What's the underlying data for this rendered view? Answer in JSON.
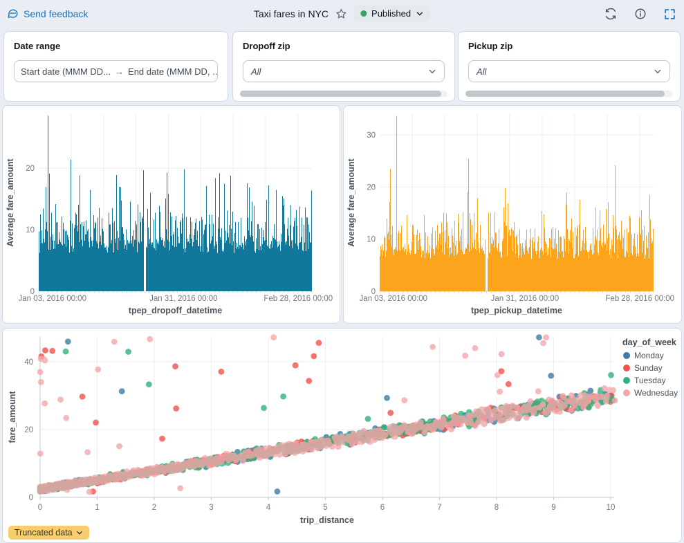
{
  "header": {
    "feedback_label": "Send feedback",
    "title": "Taxi fares in NYC",
    "status": {
      "label": "Published",
      "dot_color": "#36A264"
    }
  },
  "filters": {
    "date_range": {
      "label": "Date range",
      "start_placeholder": "Start date (MMM DD...",
      "arrow": "→",
      "end_placeholder": "End date (MMM DD, ..."
    },
    "dropoff_zip": {
      "label": "Dropoff zip",
      "value": "All"
    },
    "pickup_zip": {
      "label": "Pickup zip",
      "value": "All"
    }
  },
  "footer": {
    "truncated_label": "Truncated data"
  },
  "colors": {
    "accent_blue": "#2272B4",
    "page_bg": "#E8EEF4",
    "card_border": "#D1D9E2",
    "published_dot": "#36A264",
    "truncated_bg": "#F7CD6E",
    "grid": "#ECEEF0",
    "axis": "#C6CBD1",
    "tick_text": "#6E7781",
    "axis_title_text": "#4C555E"
  },
  "chart_data": [
    {
      "id": "avg-fare-by-dropoff",
      "type": "bar",
      "xlabel": "tpep_dropoff_datetime",
      "ylabel": "Average fare_amount",
      "x_ticks": [
        "Jan 03, 2016 00:00",
        "Jan 31, 2016 00:00",
        "Feb 28, 2016 00:00"
      ],
      "x_tick_fractions": [
        0.05,
        0.53,
        0.95
      ],
      "y_ticks": [
        0,
        10,
        20
      ],
      "ylim": [
        0,
        28.8
      ],
      "color": "#11779B",
      "seed": 12,
      "days": 59,
      "grid_weeks": 8,
      "bar_gap_fraction": 0.387,
      "peak_fraction": 0.032,
      "gen": {
        "base_min": 6.2,
        "base_var": 2.2,
        "mid_p": 0.55,
        "mid_var": 5,
        "high_p": 0.18,
        "high_add": [
          2,
          5
        ],
        "spike_p": 0.03,
        "spike_add": [
          4,
          8
        ]
      }
    },
    {
      "id": "avg-fare-by-pickup",
      "type": "bar",
      "xlabel": "tpep_pickup_datetime",
      "ylabel": "Average fare_amount",
      "x_ticks": [
        "Jan 03, 2016 00:00",
        "Jan 31, 2016 00:00",
        "Feb 28, 2016 00:00"
      ],
      "x_tick_fractions": [
        0.05,
        0.53,
        0.95
      ],
      "y_ticks": [
        0,
        10,
        20,
        30
      ],
      "ylim": [
        0,
        34
      ],
      "color": "#FCA41C",
      "seed": 99,
      "days": 59,
      "grid_weeks": 8,
      "bar_gap_fraction": 0.387,
      "peak_fraction": 0.06,
      "gen": {
        "base_min": 6.2,
        "base_var": 2.2,
        "mid_p": 0.55,
        "mid_var": 5,
        "high_p": 0.18,
        "high_add": [
          2,
          5
        ],
        "spike_p": 0.028,
        "spike_add": [
          4,
          12
        ]
      }
    },
    {
      "id": "fare-vs-distance",
      "type": "scatter",
      "xlabel": "trip_distance",
      "ylabel": "fare_amount",
      "x_ticks": [
        0,
        1,
        2,
        3,
        4,
        5,
        6,
        7,
        8,
        9,
        10
      ],
      "y_ticks": [
        0,
        20,
        40
      ],
      "xlim": [
        0,
        10.08
      ],
      "ylim": [
        0,
        47.5
      ],
      "legend_title": "day_of_week",
      "trend": {
        "intercept": 2.4,
        "slope": 2.75,
        "noise": 0.85
      },
      "outlier_rate": 0.022,
      "low_outlier_rate": 0.0015,
      "point_radius": 4.4,
      "point_opacity": 0.8,
      "series": [
        {
          "name": "Monday",
          "color": "#3D7DA3",
          "count": 330,
          "seed": 7,
          "skew": 1.25
        },
        {
          "name": "Sunday",
          "color": "#F0534A",
          "count": 330,
          "seed": 11,
          "skew": 1.35
        },
        {
          "name": "Tuesday",
          "color": "#2FB27C",
          "count": 480,
          "seed": 13,
          "skew": 1.45
        },
        {
          "name": "Wednesday",
          "color": "#F4A7A9",
          "count": 1100,
          "seed": 17,
          "skew": 2.0
        }
      ]
    }
  ]
}
